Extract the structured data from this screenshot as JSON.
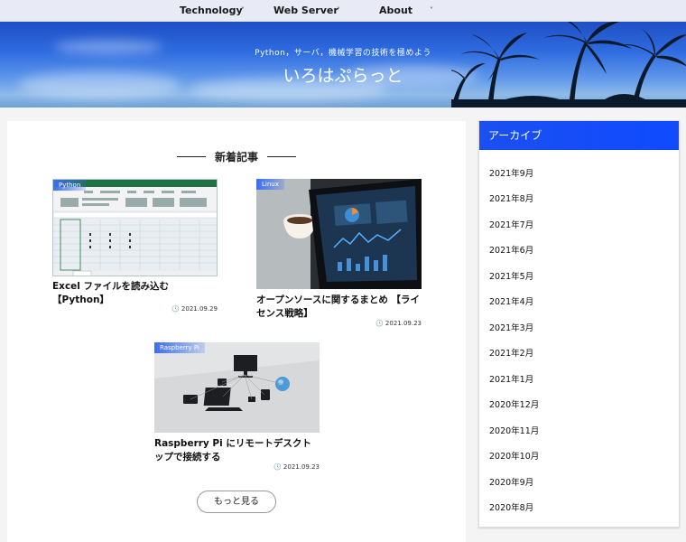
{
  "nav": {
    "items": [
      {
        "label": "Technology",
        "caret": "˅"
      },
      {
        "label": "Web Server",
        "caret": "˅"
      },
      {
        "label": "About",
        "caret": "˅"
      }
    ]
  },
  "header": {
    "tagline": "Python，サーバ，機械学習の技術を極めよう",
    "site_title": "いろはぷらっと"
  },
  "main": {
    "section_title": "新着記事",
    "posts": [
      {
        "category": "Python",
        "title": "Excel ファイルを読み込む【Python】",
        "date": "2021.09.29"
      },
      {
        "category": "Linux",
        "title": "オープンソースに関するまとめ 【ライセンス戦略】",
        "date": "2021.09.23"
      },
      {
        "category": "Raspberry Pi",
        "title": "Raspberry Pi にリモートデスクトップで接続する",
        "date": "2021.09.23"
      }
    ],
    "more_button": "もっと見る"
  },
  "sidebar": {
    "heading": "アーカイブ",
    "archives": [
      "2021年9月",
      "2021年8月",
      "2021年7月",
      "2021年6月",
      "2021年5月",
      "2021年4月",
      "2021年3月",
      "2021年2月",
      "2021年1月",
      "2020年12月",
      "2020年11月",
      "2020年10月",
      "2020年9月",
      "2020年8月"
    ]
  },
  "icons": {
    "date": "clock-icon"
  },
  "colors": {
    "accent": "#1b4ff0",
    "nav_bg": "#e8eaf6"
  }
}
